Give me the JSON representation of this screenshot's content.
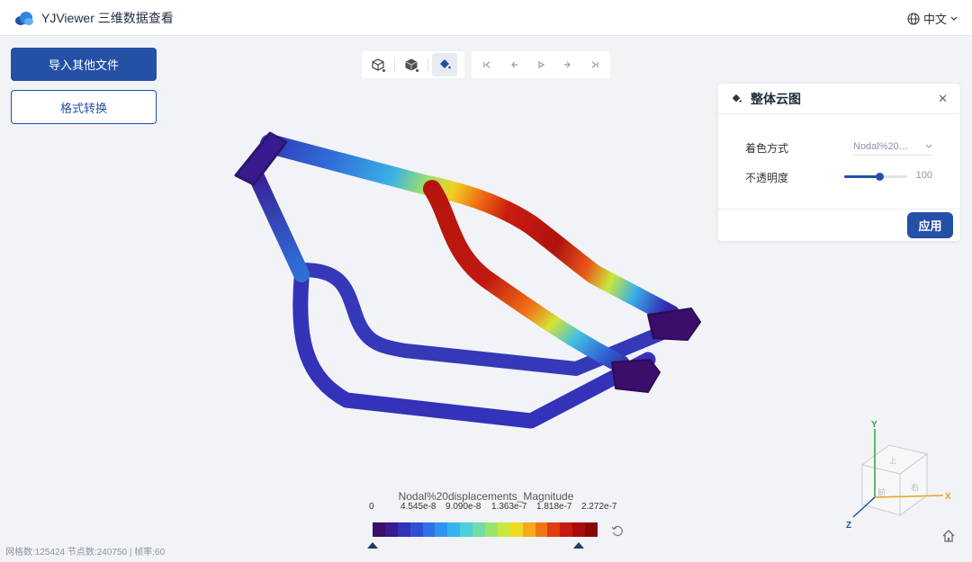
{
  "header": {
    "app_title": "YJViewer 三维数据查看",
    "language": "中文"
  },
  "sidebar": {
    "import_button": "导入其他文件",
    "convert_button": "格式转换"
  },
  "toolbar": {
    "view_tools": [
      "view-cube-icon",
      "solid-box-icon",
      "paint-bucket-icon"
    ],
    "active_tool": "paint-bucket-icon",
    "playback": [
      "first-frame-icon",
      "prev-frame-icon",
      "play-icon",
      "next-frame-icon",
      "last-frame-icon"
    ]
  },
  "panel": {
    "title": "整体云图",
    "color_mode_label": "着色方式",
    "color_mode_value": "Nodal%20…",
    "opacity_label": "不透明度",
    "opacity_value": "100",
    "apply_button": "应用"
  },
  "legend": {
    "title": "Nodal%20displacements_Magnitude",
    "ticks": [
      "0",
      "4.545e-8",
      "9.090e-8",
      "1.363e-7",
      "1.818e-7",
      "2.272e-7"
    ],
    "colors": [
      "#3b0e6b",
      "#3a1a8f",
      "#3432b8",
      "#2f4fd6",
      "#2e72e6",
      "#2f94ee",
      "#34b4ef",
      "#4ccfd8",
      "#71dca7",
      "#9ae46d",
      "#c8e83e",
      "#ecdb22",
      "#f6ab19",
      "#f17515",
      "#e03d10",
      "#c51a10",
      "#a50d0d",
      "#8a0707"
    ]
  },
  "axes": {
    "x": "X",
    "y": "Y",
    "z": "Z"
  },
  "gizmo_faces": [
    "上",
    "前",
    "右"
  ],
  "status": {
    "text": "网格数:125424 节点数:240750 | 帧率:60"
  },
  "colors": {
    "accent": "#2450a6"
  }
}
